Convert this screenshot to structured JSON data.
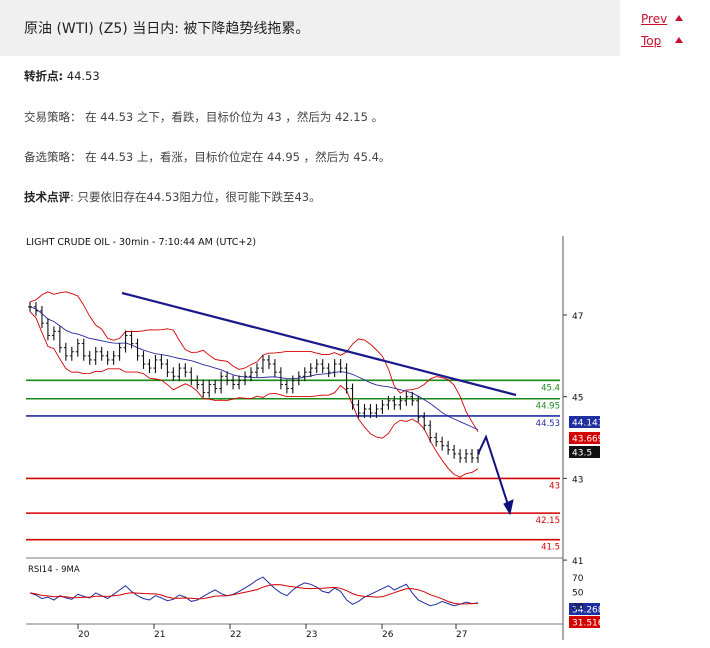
{
  "header": {
    "title": "原油 (WTI) (Z5) 当日内: 被下降趋势线拖累。",
    "prev_label": "Prev",
    "top_label": "Top"
  },
  "pivot": {
    "label": "转折点:",
    "value": "44.53"
  },
  "strategy": {
    "label": "交易策略：",
    "text": "在 44.53 之下，看跌，目标价位为 43 ，然后为 42.15 。"
  },
  "alternative": {
    "label": "备选策略：",
    "text": "在 44.53 上，看涨，目标价位定在 44.95 ，然后为 45.4。"
  },
  "comment": {
    "label": "技术点评",
    "text": ": 只要依旧存在44.53阻力位，很可能下跌至43。"
  },
  "colors": {
    "green_level": "#1a8a1a",
    "blue_level": "#1e2fa0",
    "red_level": "#d40000",
    "trendline": "#1a1a8c",
    "bollinger": "#d40000",
    "ma": "#2a2aa0",
    "price": "#111111"
  },
  "chart_data": {
    "type": "line",
    "title": "LIGHT CRUDE OIL - 30min - 7:10:44 AM (UTC+2)",
    "x_tick_labels": [
      "20",
      "21",
      "22",
      "23",
      "26",
      "27"
    ],
    "y_tick_labels": [
      "47",
      "45",
      "43",
      "41"
    ],
    "ylim": [
      40.6,
      47.9
    ],
    "close_series": [
      47.2,
      47.1,
      46.8,
      46.5,
      46.6,
      46.2,
      46.0,
      46.1,
      46.3,
      46.0,
      45.9,
      46.1,
      46.0,
      45.9,
      46.0,
      46.2,
      46.5,
      46.3,
      46.0,
      45.8,
      45.7,
      45.9,
      45.8,
      45.6,
      45.5,
      45.7,
      45.6,
      45.4,
      45.3,
      45.1,
      45.3,
      45.2,
      45.5,
      45.4,
      45.3,
      45.4,
      45.5,
      45.6,
      45.7,
      45.9,
      45.8,
      45.6,
      45.3,
      45.2,
      45.4,
      45.5,
      45.6,
      45.7,
      45.8,
      45.7,
      45.6,
      45.8,
      45.7,
      45.2,
      44.8,
      44.6,
      44.7,
      44.6,
      44.7,
      44.8,
      44.9,
      44.8,
      44.9,
      45.0,
      44.9,
      44.5,
      44.3,
      44.0,
      43.9,
      43.8,
      43.7,
      43.6,
      43.5,
      43.6,
      43.5,
      43.6
    ],
    "series": [
      {
        "name": "44.143",
        "value": 44.143
      },
      {
        "name": "43.669",
        "value": 43.669
      },
      {
        "name": "43.5",
        "value": 43.5
      }
    ],
    "horizontal_levels": [
      {
        "label": "45.4",
        "value": 45.4,
        "color": "green"
      },
      {
        "label": "44.95",
        "value": 44.95,
        "color": "green"
      },
      {
        "label": "44.53",
        "value": 44.53,
        "color": "blue"
      },
      {
        "label": "43",
        "value": 43,
        "color": "red"
      },
      {
        "label": "42.15",
        "value": 42.15,
        "color": "red"
      },
      {
        "label": "41.5",
        "value": 41.5,
        "color": "red"
      }
    ],
    "rsi": {
      "title": "RSI14 - 9MA",
      "y_tick_labels": [
        "70",
        "50",
        "30"
      ],
      "ylim": [
        10,
        80
      ],
      "current_values": [
        "34.268",
        "31.5166"
      ],
      "values": [
        48,
        45,
        40,
        42,
        38,
        44,
        41,
        39,
        46,
        43,
        41,
        48,
        44,
        40,
        46,
        52,
        58,
        50,
        44,
        40,
        38,
        44,
        41,
        37,
        39,
        45,
        42,
        36,
        38,
        43,
        48,
        52,
        47,
        44,
        46,
        50,
        55,
        60,
        66,
        70,
        62,
        54,
        48,
        44,
        52,
        58,
        62,
        60,
        56,
        50,
        48,
        55,
        50,
        38,
        32,
        36,
        42,
        46,
        50,
        54,
        58,
        52,
        56,
        60,
        48,
        38,
        34,
        30,
        32,
        36,
        33,
        30,
        32,
        35,
        33,
        34
      ]
    }
  }
}
